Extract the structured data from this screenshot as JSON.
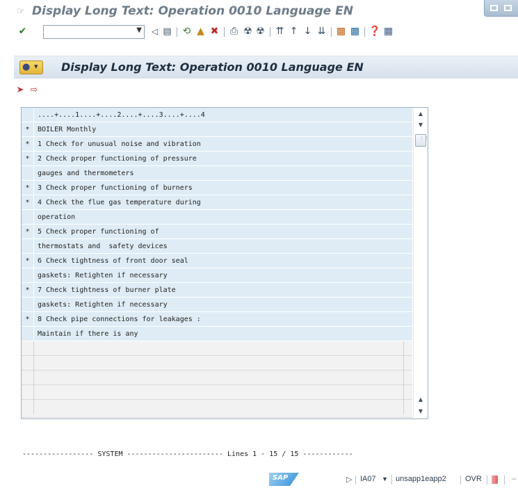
{
  "window": {
    "title": "Display Long Text: Operation 0010 Language EN"
  },
  "toolbar": {
    "command_field_value": ""
  },
  "screen": {
    "title": "Display Long Text: Operation 0010 Language EN"
  },
  "editor": {
    "ruler": "....+....1....+....2....+....3....+....4",
    "lines": [
      {
        "format": "*",
        "text": "BOILER Monthly"
      },
      {
        "format": "*",
        "text": "1 Check for unusual noise and vibration"
      },
      {
        "format": "*",
        "text": "2 Check proper functioning of pressure"
      },
      {
        "format": "",
        "text": "gauges and thermometers"
      },
      {
        "format": "*",
        "text": "3 Check proper functioning of burners"
      },
      {
        "format": "*",
        "text": "4 Check the flue gas temperature during"
      },
      {
        "format": "",
        "text": "operation"
      },
      {
        "format": "*",
        "text": "5 Check proper functioning of"
      },
      {
        "format": "",
        "text": "thermostats and  safety devices"
      },
      {
        "format": "*",
        "text": "6 Check tightness of front door seal"
      },
      {
        "format": "",
        "text": "gaskets: Retighten if necessary"
      },
      {
        "format": "*",
        "text": "7 Check tightness of burner plate"
      },
      {
        "format": "",
        "text": "gaskets: Retighten if necessary"
      },
      {
        "format": "*",
        "text": "8 Check pipe connections for leakages :"
      },
      {
        "format": "",
        "text": "Maintain if there is any"
      }
    ],
    "footer": "----------------- SYSTEM ----------------------- Lines 1 - 15 / 15 ------------"
  },
  "statusbar": {
    "transaction": "IA07",
    "server": "unsapp1eapp2",
    "mode": "OVR"
  },
  "icons": {
    "title": "display-mode-icon",
    "confirm": "green-check-icon",
    "back": "back-arrow-icon",
    "exit": "exit-icon",
    "cancel": "cancel-icon",
    "save": "save-icon"
  }
}
